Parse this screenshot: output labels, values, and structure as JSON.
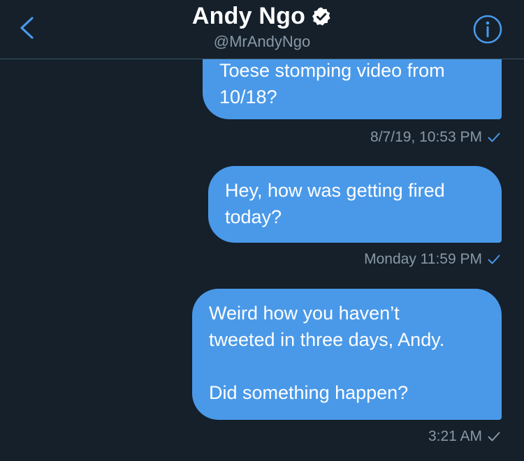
{
  "header": {
    "title": "Andy Ngo",
    "handle": "@MrAndyNgo",
    "back_icon": "chevron-left-icon",
    "verified_icon": "verified-badge-icon",
    "info_icon": "info-icon"
  },
  "colors": {
    "background": "#15202b",
    "bubble": "#4a99e9",
    "accent": "#4a99e9",
    "muted": "#8899a6"
  },
  "messages": [
    {
      "text": "Toese stomping video from\n10/18?",
      "timestamp": "8/7/19, 10:53 PM",
      "status": "read"
    },
    {
      "text": "Hey, how was getting fired\ntoday?",
      "timestamp": "Monday 11:59 PM",
      "status": "read"
    },
    {
      "text": "Weird how you haven’t\ntweeted in three days, Andy.\n\nDid something happen?",
      "timestamp": "3:21 AM",
      "status": "sent"
    }
  ]
}
